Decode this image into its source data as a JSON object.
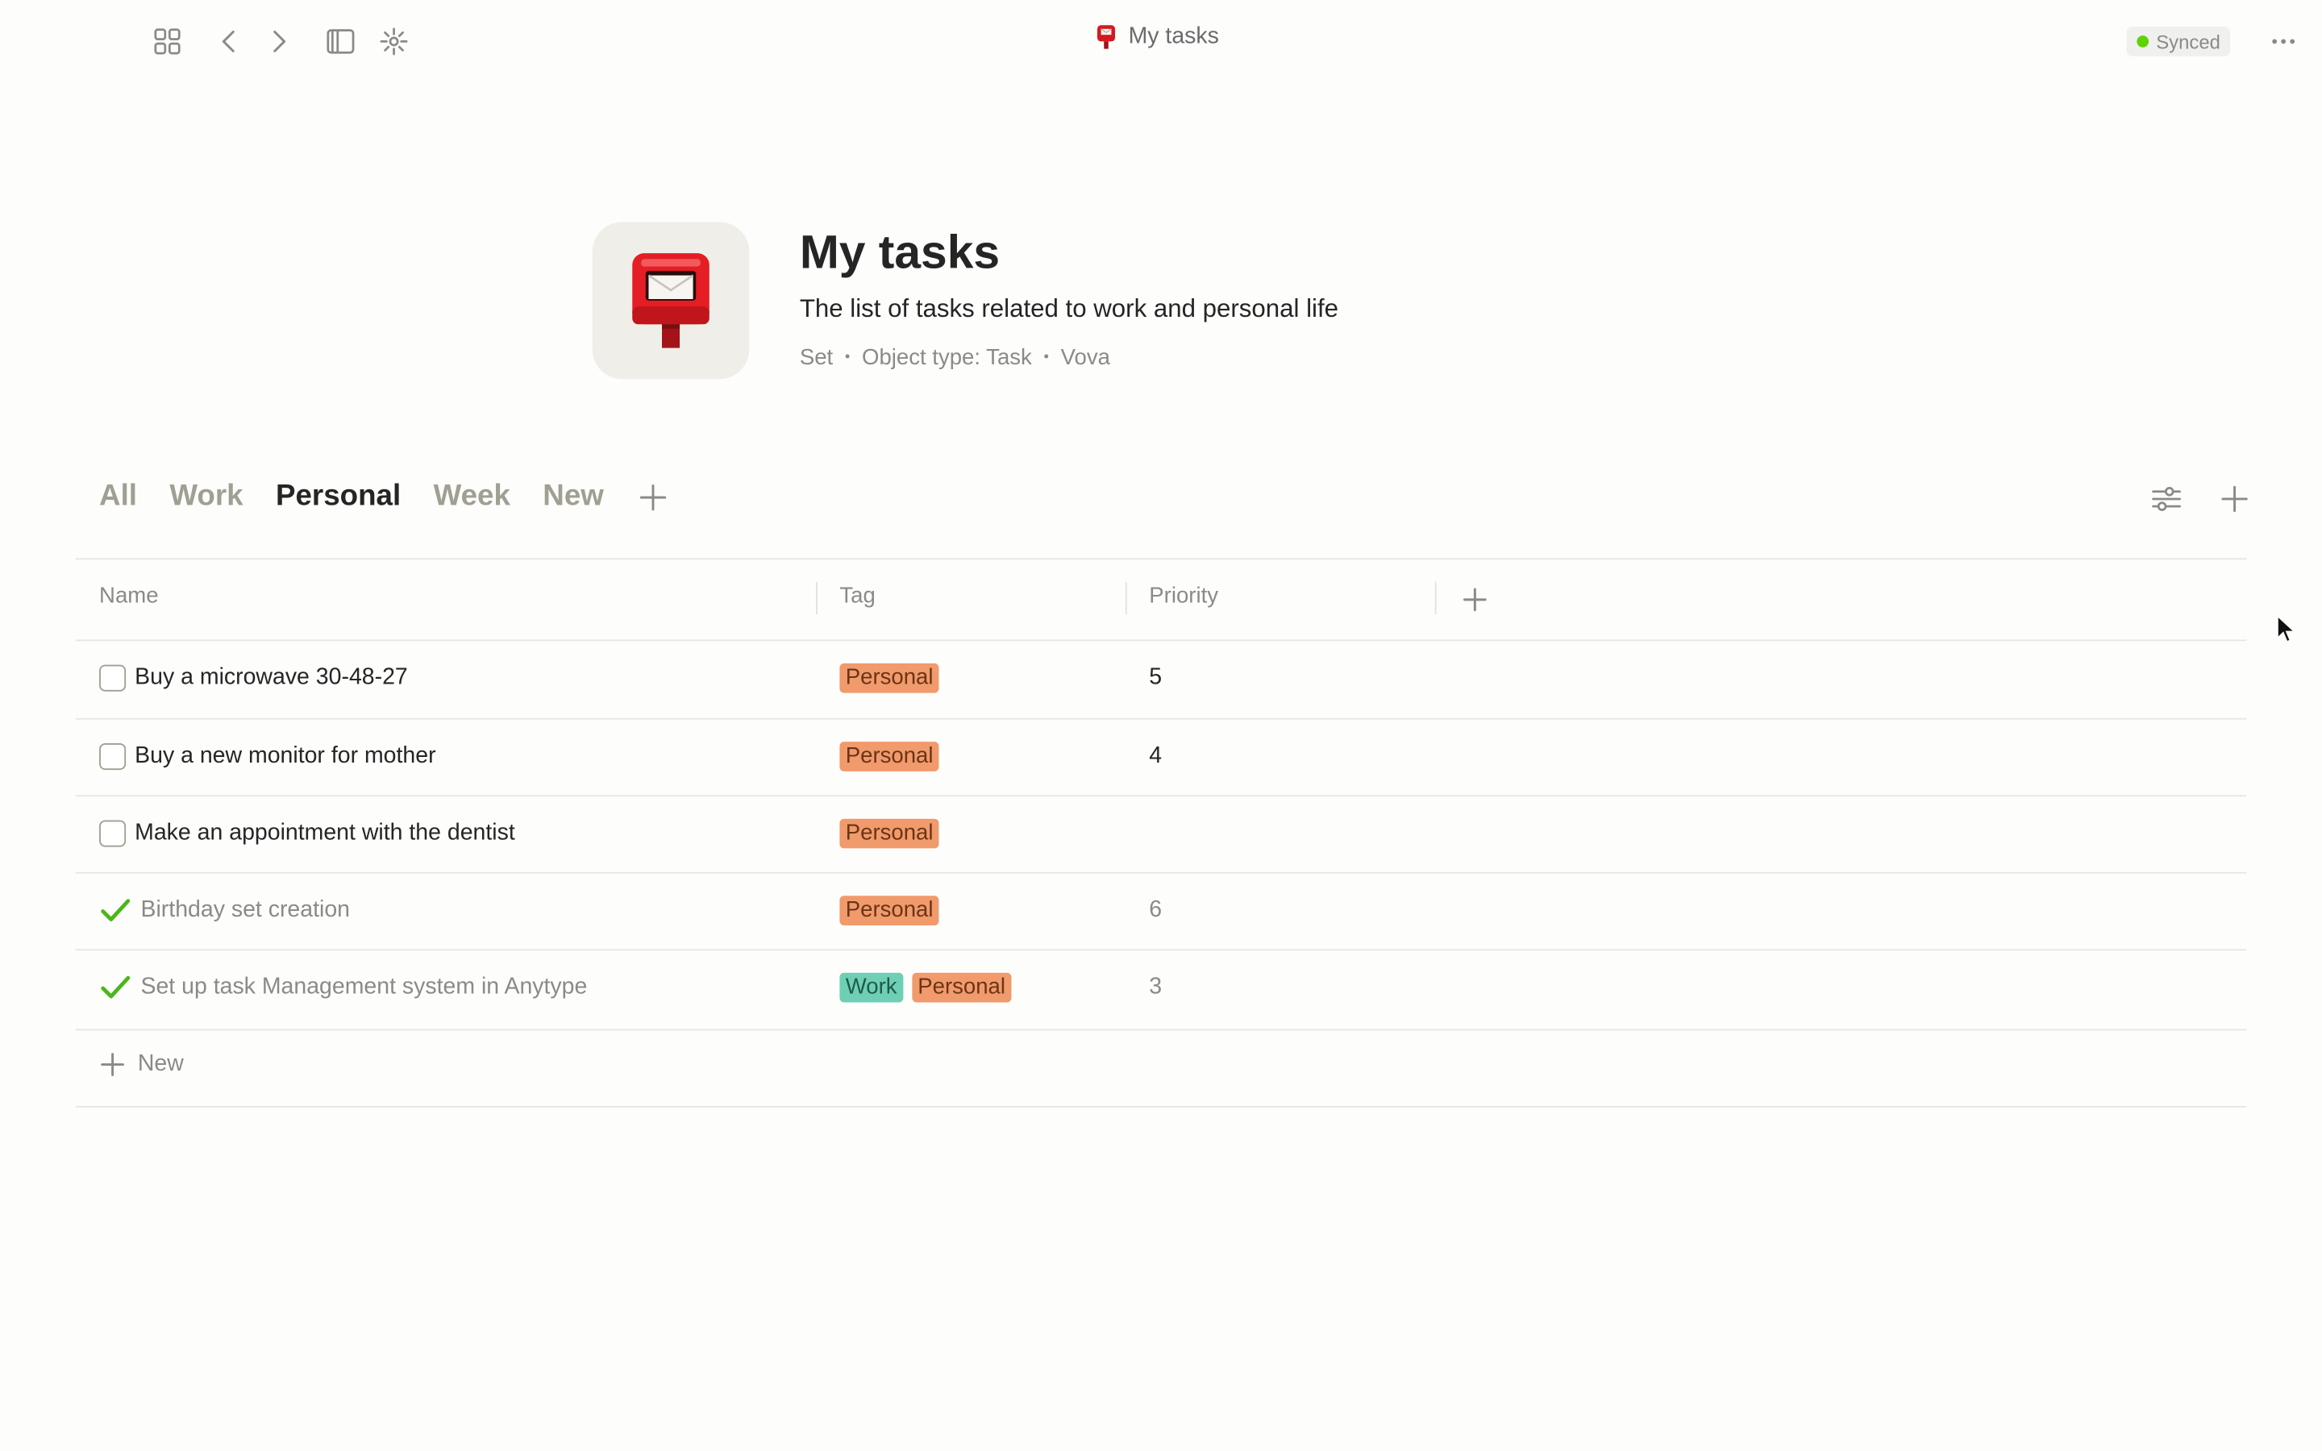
{
  "topbar": {
    "title": "My tasks",
    "sync_status": "Synced",
    "icons": [
      "grid-icon",
      "back-icon",
      "forward-icon",
      "sidebar-icon",
      "graph-icon",
      "more-icon"
    ]
  },
  "object": {
    "icon": "postbox-icon",
    "title": "My tasks",
    "description": "The list of tasks related to work and personal life",
    "meta": {
      "layout": "Set",
      "object_type": "Object type: Task",
      "author": "Vova"
    }
  },
  "views": {
    "tabs": [
      "All",
      "Work",
      "Personal",
      "Week",
      "New"
    ],
    "active": "Personal"
  },
  "table": {
    "columns": [
      "Name",
      "Tag",
      "Priority"
    ],
    "rows": [
      {
        "name": "Buy a microwave 30-48-27",
        "done": false,
        "tags": [
          "Personal"
        ],
        "priority": "5"
      },
      {
        "name": "Buy a new monitor for mother",
        "done": false,
        "tags": [
          "Personal"
        ],
        "priority": "4"
      },
      {
        "name": "Make an appointment with the dentist",
        "done": false,
        "tags": [
          "Personal"
        ],
        "priority": ""
      },
      {
        "name": "Birthday set creation",
        "done": true,
        "tags": [
          "Personal"
        ],
        "priority": "6"
      },
      {
        "name": "Set up task Management system in Anytype",
        "done": true,
        "tags": [
          "Work",
          "Personal"
        ],
        "priority": "3"
      }
    ],
    "new_label": "New"
  },
  "colors": {
    "tag_personal": "#f19a6c",
    "tag_work": "#6ecfb5",
    "check_green": "#5dd400",
    "muted_text": "#8a8a86"
  }
}
